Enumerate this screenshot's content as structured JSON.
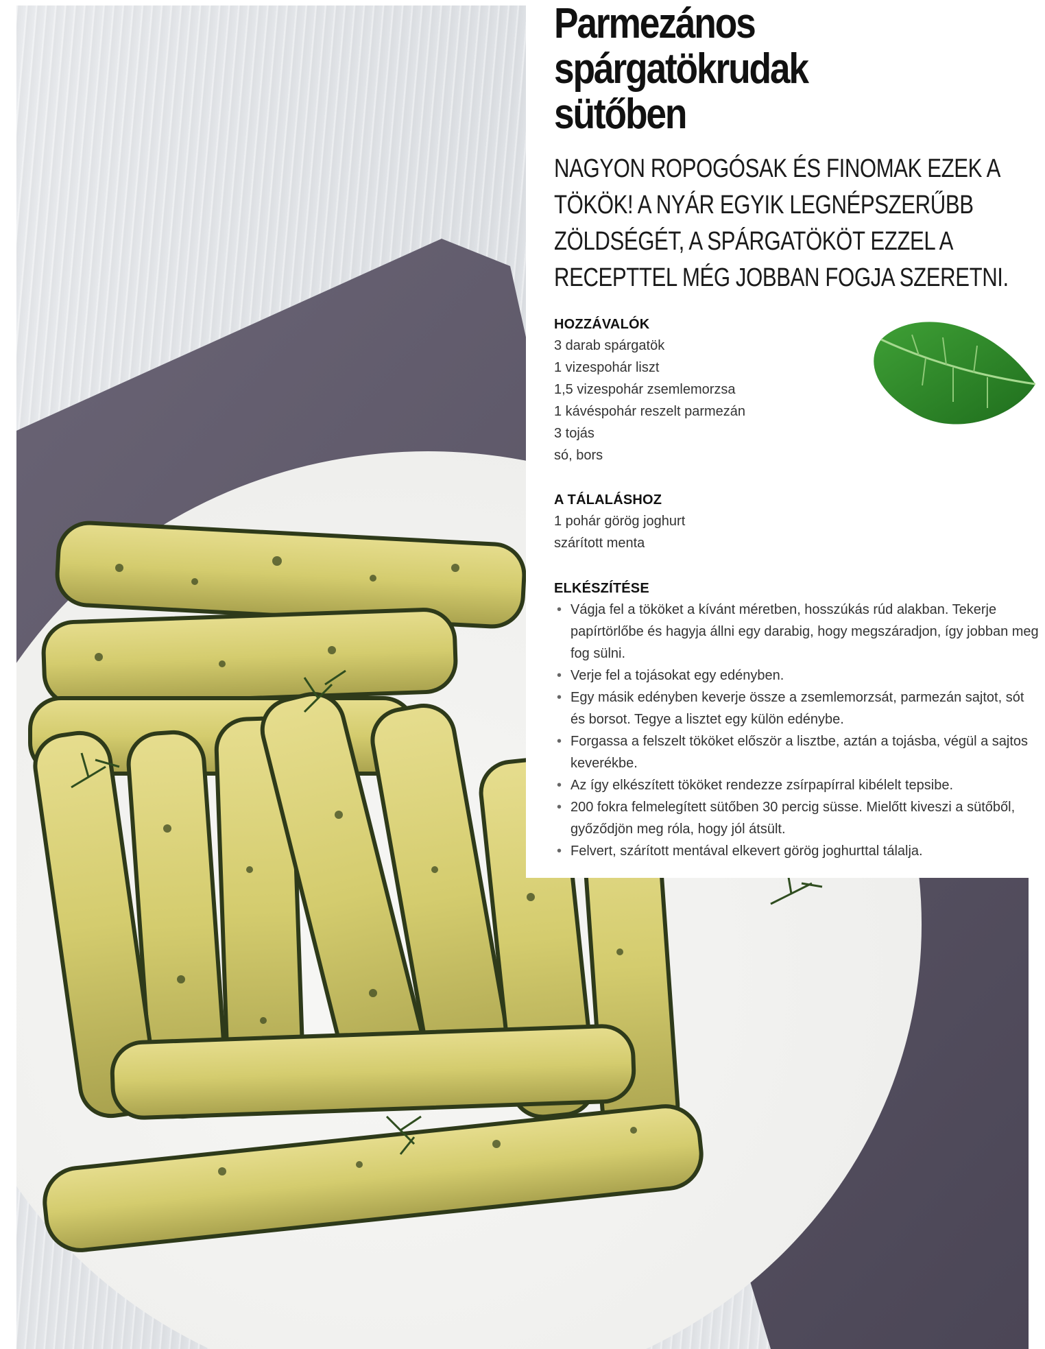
{
  "recipe": {
    "title": "Parmezános\nspárgatökrudak\nsütőben",
    "subtitle": "NAGYON ROPOGÓSAK ÉS FINOMAK EZEK A TÖKÖK! A NYÁR EGYIK LEGNÉPSZERŰBB ZÖLDSÉGÉT, A SPÁRGATÖKÖT EZZEL A RECEPTTEL MÉG JOBBAN FOGJA SZERETNI.",
    "ingredients": {
      "heading": "HOZZÁVALÓK",
      "items": [
        "3 darab spárgatök",
        "1 vizespohár liszt",
        "1,5 vizespohár zsemlemorzsa",
        "1 kávéspohár reszelt parmezán",
        "3 tojás",
        "só, bors"
      ]
    },
    "serving": {
      "heading": "A TÁLALÁSHOZ",
      "items": [
        "1 pohár görög joghurt",
        "szárított menta"
      ]
    },
    "method": {
      "heading": "ELKÉSZÍTÉSE",
      "bullet": "•",
      "steps": [
        "Vágja fel a tököket a kívánt méretben, hosszúkás rúd alakban. Tekerje papírtörlőbe és hagyja állni egy darabig, hogy megszáradjon, így jobban meg fog sülni.",
        "Verje fel a tojásokat egy edényben.",
        "Egy másik edényben keverje össze a zsemlemorzsát, parmezán sajtot, sót és borsot. Tegye a lisztet egy külön edénybe.",
        "Forgassa a felszelt tököket először a lisztbe, aztán a tojásba, végül a sajtos keverékbe.",
        "Az így elkészített tököket rendezze zsírpapírral kibélelt tepsibe.",
        "200 fokra felmelegített sütőben 30 percig süsse. Mielőtt kiveszi a sütőből, győződjön meg róla, hogy jól átsült.",
        "Felvert, szárított mentával elkevert görög joghurttal tálalja."
      ]
    }
  },
  "colors": {
    "zucchini_skin": "#3a4a22",
    "zucchini_flesh": "#d9d58a",
    "napkin": "#5b5566",
    "plate": "#f4f4f2",
    "mint": "#2f8a2a"
  }
}
